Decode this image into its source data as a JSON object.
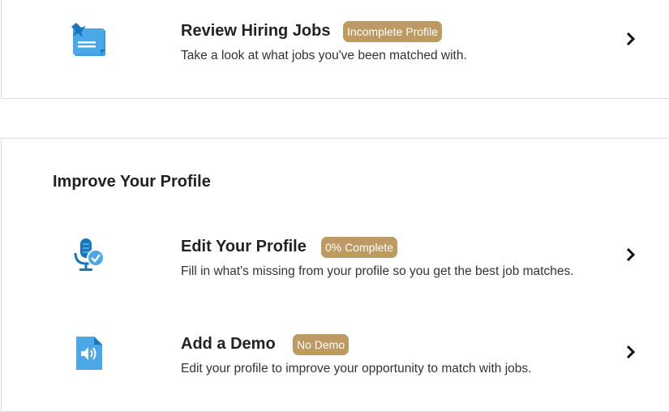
{
  "jobs_card": {
    "title": "Review Hiring Jobs",
    "badge": "Incomplete Profile",
    "description": "Take a look at what jobs you've been matched with.",
    "icon": "pinned-note-icon"
  },
  "improve_section": {
    "heading": "Improve Your Profile",
    "items": [
      {
        "title": "Edit Your Profile",
        "badge": "0% Complete",
        "description": "Fill in what's missing from your profile so you get the best job matches.",
        "icon": "microphone-check-icon"
      },
      {
        "title": "Add a Demo",
        "badge": "No Demo",
        "description": "Edit your profile to improve your opportunity to match with jobs.",
        "icon": "audio-file-icon"
      }
    ]
  },
  "colors": {
    "badge": "#bc9a62",
    "icon_dark": "#1a75bb",
    "icon_light": "#4aa8e8"
  }
}
